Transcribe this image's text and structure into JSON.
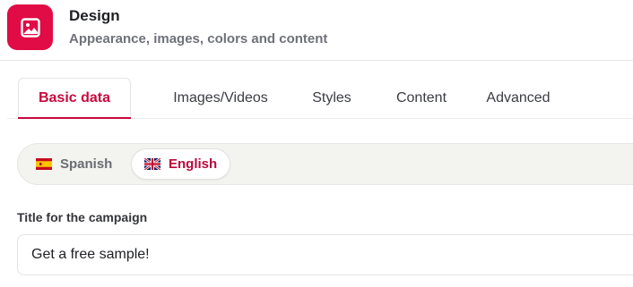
{
  "header": {
    "title": "Design",
    "subtitle": "Appearance, images, colors and content",
    "icon": "image-icon",
    "accent_color": "#e10b45"
  },
  "tabs": [
    {
      "label": "Basic data",
      "active": true
    },
    {
      "label": "Images/Videos",
      "active": false
    },
    {
      "label": "Styles",
      "active": false
    },
    {
      "label": "Content",
      "active": false
    },
    {
      "label": "Advanced",
      "active": false
    }
  ],
  "languages": [
    {
      "label": "Spanish",
      "flag": "spain-flag-icon",
      "selected": false
    },
    {
      "label": "English",
      "flag": "uk-flag-icon",
      "selected": true
    }
  ],
  "campaign_title": {
    "label": "Title for the campaign",
    "value": "Get a free sample!"
  },
  "colors": {
    "accent": "#c8093e",
    "language_bar_bg": "#f3f3ef"
  }
}
